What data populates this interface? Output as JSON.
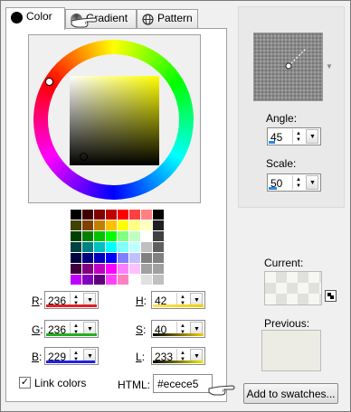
{
  "tabs": [
    {
      "label": "Color",
      "icon": "black-circle-icon"
    },
    {
      "label": "Gradient",
      "icon": "gradient-circle-icon"
    },
    {
      "label": "Pattern",
      "icon": "globe-icon"
    }
  ],
  "rgb": {
    "r": {
      "label": "R",
      "value": "236",
      "bar_color": "#e02020"
    },
    "g": {
      "label": "G",
      "value": "236",
      "bar_color": "#20b020"
    },
    "b": {
      "label": "B",
      "value": "229",
      "bar_color": "#2020e0"
    }
  },
  "hsl": {
    "h": {
      "label": "H",
      "value": "42",
      "bar_color": "#f0d000"
    },
    "s": {
      "label": "S",
      "value": "40",
      "bar_color": "#000000"
    },
    "l": {
      "label": "L",
      "value": "233",
      "bar_color": "#e0e000"
    }
  },
  "link_colors": {
    "label": "Link colors",
    "checked": true
  },
  "html_field": {
    "label": "HTML:",
    "value": "#ecece5"
  },
  "pattern_controls": {
    "angle": {
      "label": "Angle:",
      "value": "45"
    },
    "scale": {
      "label": "Scale:",
      "value": "50"
    }
  },
  "current": {
    "label": "Current:"
  },
  "previous": {
    "label": "Previous:",
    "color": "#ecece5"
  },
  "add_swatch_button": "Add to swatches...",
  "palette_colors": [
    [
      "#000000",
      "#400000",
      "#800000",
      "#c00000",
      "#ff0000",
      "#ff4040",
      "#ff8080",
      "#000000"
    ],
    [
      "#404000",
      "#804000",
      "#c08000",
      "#ffc000",
      "#ffff00",
      "#ffff80",
      "#ffffc0",
      "#202020"
    ],
    [
      "#004000",
      "#008000",
      "#00c000",
      "#00ff00",
      "#80ff80",
      "#c0ffc0",
      "#ffffff",
      "#404040"
    ],
    [
      "#004040",
      "#008080",
      "#00c0c0",
      "#00ffff",
      "#80ffff",
      "#c0ffff",
      "#c0c0c0",
      "#606060"
    ],
    [
      "#000040",
      "#000080",
      "#0000c0",
      "#0000ff",
      "#8080ff",
      "#c0c0ff",
      "#808080",
      "#808080"
    ],
    [
      "#400040",
      "#800080",
      "#c000c0",
      "#ff00ff",
      "#ff80ff",
      "#ffc0ff",
      "#a0a0a0",
      "#a0a0a0"
    ],
    [
      "#c000ff",
      "#8000c0",
      "#600080",
      "#ff40ff",
      "#ff80c0",
      "#ffffff",
      "#e0e0e0",
      "#c0c0c0"
    ]
  ]
}
